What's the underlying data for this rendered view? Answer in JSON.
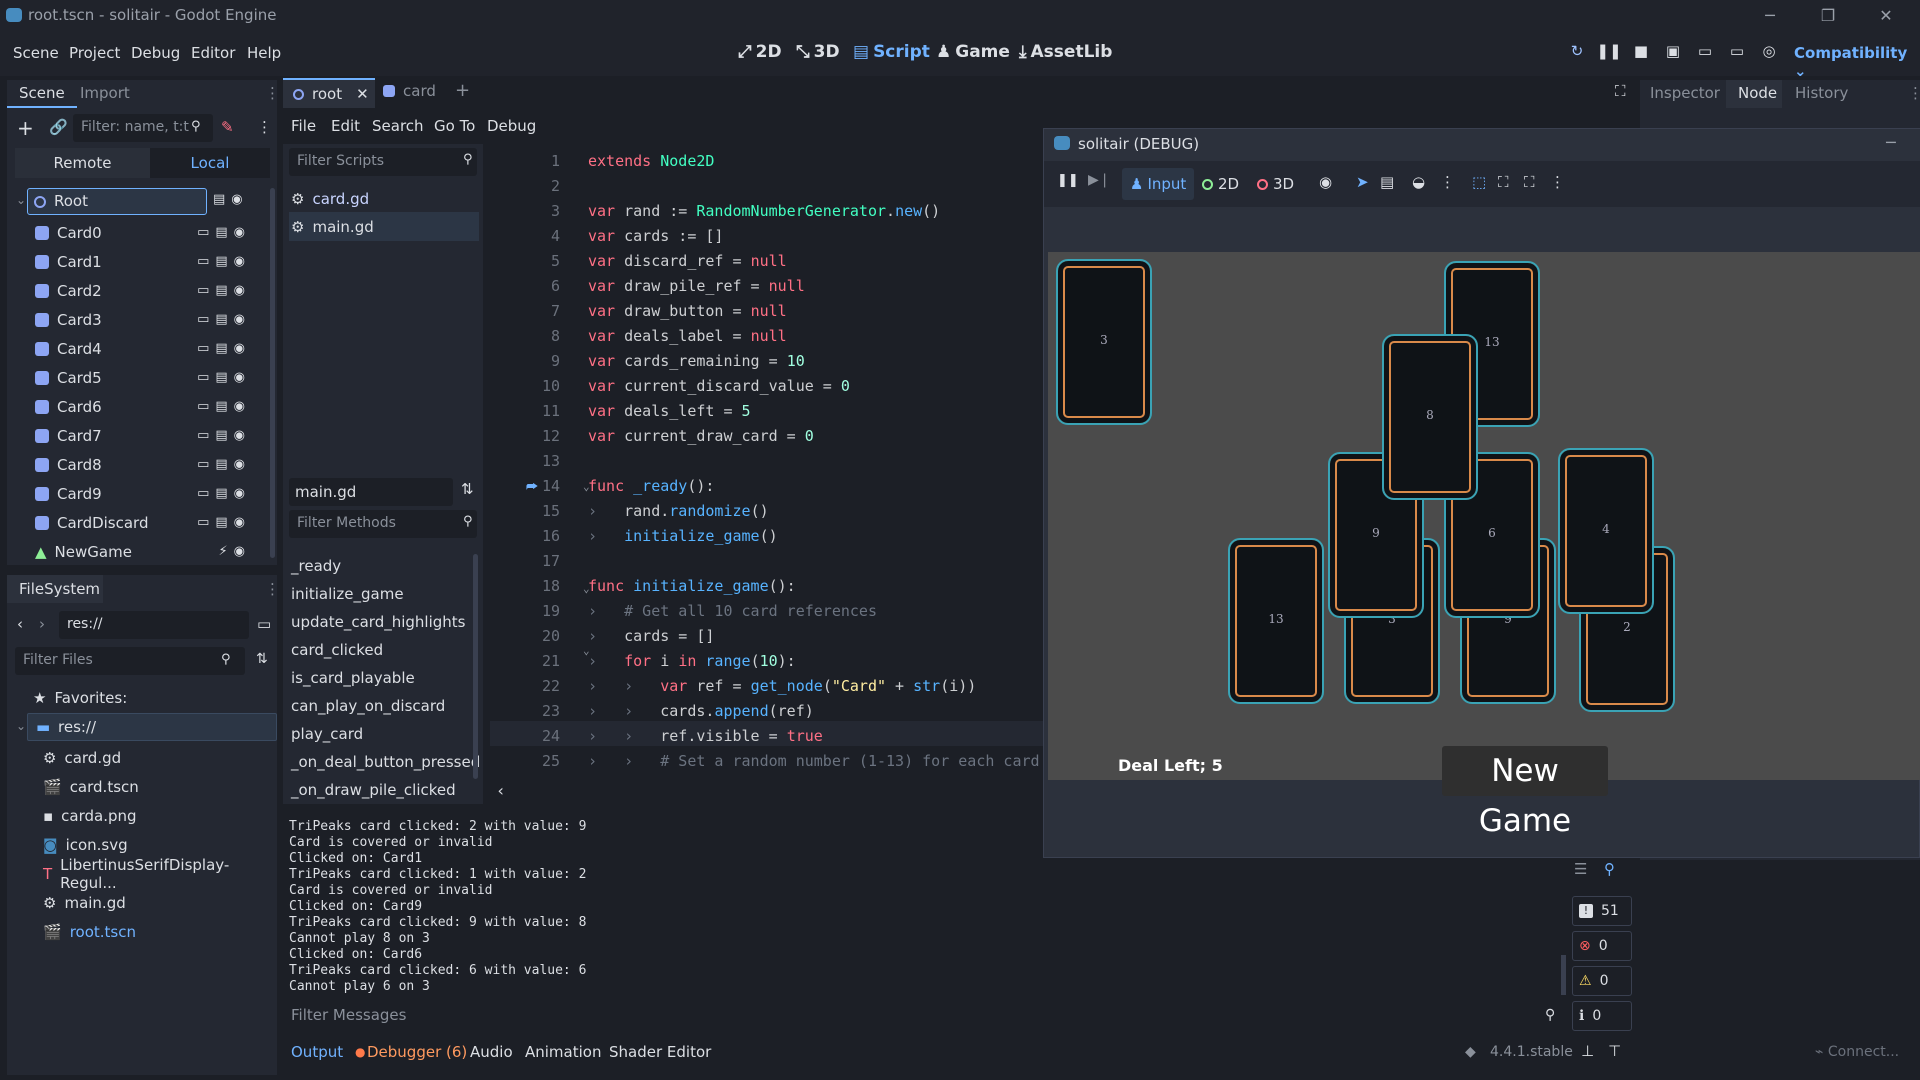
{
  "window": {
    "title": "root.tscn - solitair - Godot Engine"
  },
  "menus": [
    "Scene",
    "Project",
    "Debug",
    "Editor",
    "Help"
  ],
  "workspaces": [
    {
      "label": "2D",
      "icon": "2d-icon"
    },
    {
      "label": "3D",
      "icon": "3d-icon"
    },
    {
      "label": "Script",
      "icon": "script-icon",
      "active": true
    },
    {
      "label": "Game",
      "icon": "game-icon"
    },
    {
      "label": "AssetLib",
      "icon": "assetlib-icon"
    }
  ],
  "renderer": "Compatibility",
  "scene_dock": {
    "tabs": [
      "Scene",
      "Import"
    ],
    "filter_placeholder": "Filter: name, t:t",
    "remote_label": "Remote",
    "local_label": "Local",
    "root": "Root",
    "nodes": [
      "Card0",
      "Card1",
      "Card2",
      "Card3",
      "Card4",
      "Card5",
      "Card6",
      "Card7",
      "Card8",
      "Card9",
      "CardDiscard",
      "NewGame"
    ]
  },
  "filesystem": {
    "tab": "FileSystem",
    "path": "res://",
    "filter_placeholder": "Filter Files",
    "favorites_label": "Favorites:",
    "root": "res://",
    "files": [
      "card.gd",
      "card.tscn",
      "carda.png",
      "icon.svg",
      "LibertinusSerifDisplay-Regul...",
      "main.gd",
      "root.tscn"
    ]
  },
  "editor_tabs": {
    "open": [
      "root",
      "card"
    ]
  },
  "script_menu": [
    "File",
    "Edit",
    "Search",
    "Go To",
    "Debug"
  ],
  "script_list": {
    "filter_placeholder": "Filter Scripts",
    "scripts": [
      "card.gd",
      "main.gd"
    ],
    "current": "main.gd",
    "methods_placeholder": "Filter Methods",
    "methods": [
      "_ready",
      "initialize_game",
      "update_card_highlights",
      "card_clicked",
      "is_card_playable",
      "can_play_on_discard",
      "play_card",
      "_on_deal_button_pressed",
      "_on_draw_pile_clicked"
    ]
  },
  "code": {
    "line_numbers": [
      "1",
      "2",
      "3",
      "4",
      "5",
      "6",
      "7",
      "8",
      "9",
      "10",
      "11",
      "12",
      "13",
      "14",
      "15",
      "16",
      "17",
      "18",
      "19",
      "20",
      "21",
      "22",
      "23",
      "24",
      "25"
    ],
    "lines": [
      "extends Node2D",
      "",
      "var rand := RandomNumberGenerator.new()",
      "var cards := []",
      "var discard_ref = null",
      "var draw_pile_ref = null",
      "var draw_button = null",
      "var deals_label = null",
      "var cards_remaining = 10",
      "var current_discard_value = 0",
      "var deals_left = 5",
      "var current_draw_card = 0",
      "",
      "func _ready():",
      "    rand.randomize()",
      "    initialize_game()",
      "",
      "func initialize_game():",
      "    # Get all 10 card references",
      "    cards = []",
      "    for i in range(10):",
      "        var ref = get_node(\"Card\" + str(i))",
      "        cards.append(ref)",
      "        ref.visible = true",
      "        # Set a random number (1-13) for each card"
    ]
  },
  "output": {
    "lines": [
      "TriPeaks card clicked: 2 with value: 9",
      "Card is covered or invalid",
      "Clicked on: Card1",
      "TriPeaks card clicked: 1 with value: 2",
      "Card is covered or invalid",
      "Clicked on: Card9",
      "TriPeaks card clicked: 9 with value: 8",
      "Cannot play 8 on 3",
      "Clicked on: Card6",
      "TriPeaks card clicked: 6 with value: 6",
      "Cannot play 6 on 3"
    ],
    "filter_placeholder": "Filter Messages",
    "counts": {
      "messages": "51",
      "errors": "0",
      "warnings": "0",
      "info": "0"
    }
  },
  "bottom_tabs": [
    "Output",
    "Debugger (6)",
    "Audio",
    "Animation",
    "Shader Editor"
  ],
  "version": "4.4.1.stable",
  "right_dock": {
    "tabs": [
      "Inspector",
      "Node",
      "History"
    ],
    "connect_label": "Connect..."
  },
  "game_window": {
    "title": "solitair (DEBUG)",
    "input_label": "Input",
    "mode_2d": "2D",
    "mode_3d": "3D",
    "deal_label": "Deal Left; 5",
    "new_game": "New Game",
    "cards": {
      "draw": "3",
      "top": "13",
      "peak": "8",
      "m1": "9",
      "m2": "6",
      "m3": "4",
      "b1": "13",
      "b2": "3",
      "b3": "9",
      "b4": "2"
    }
  }
}
